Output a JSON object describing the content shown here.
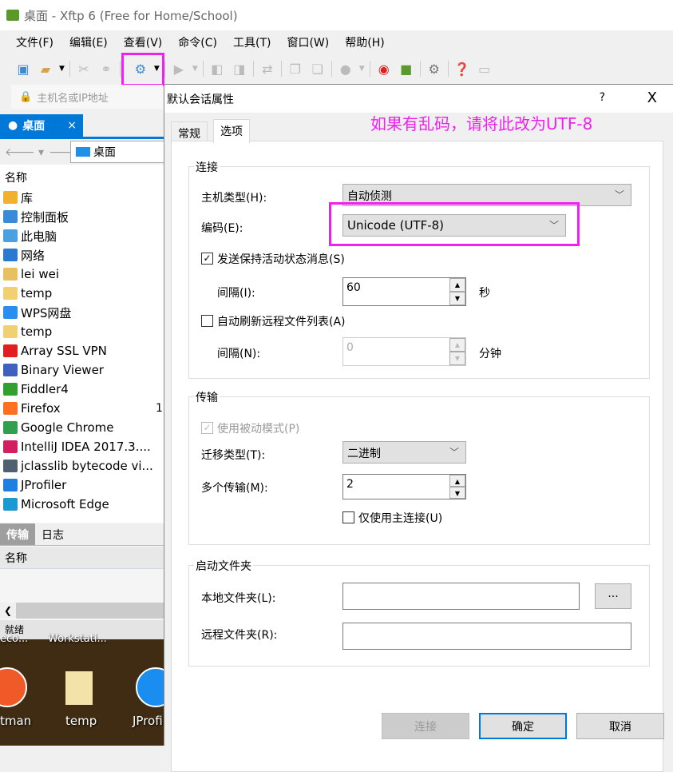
{
  "window": {
    "title": "桌面 - Xftp 6 (Free for Home/School)"
  },
  "menu": [
    "文件(F)",
    "编辑(E)",
    "查看(V)",
    "命令(C)",
    "工具(T)",
    "窗口(W)",
    "帮助(H)"
  ],
  "toolbar": {
    "icons": [
      "new-session-icon",
      "open-folder-icon",
      "disconnect-icon",
      "reconnect-icon",
      "default-session-properties-icon",
      "play-icon",
      "upload-icon",
      "download-icon",
      "sync-icon",
      "copy-icon",
      "paste-icon",
      "record-icon",
      "xshell-icon",
      "xftp-icon",
      "settings-icon",
      "help-icon",
      "chat-icon"
    ]
  },
  "address": {
    "placeholder": "主机名或IP地址"
  },
  "local": {
    "tab": "桌面",
    "path": "桌面",
    "column": "名称",
    "truncated_col": "1",
    "items": [
      {
        "name": "库",
        "color": "#f0b030"
      },
      {
        "name": "控制面板",
        "color": "#3a8ad8"
      },
      {
        "name": "此电脑",
        "color": "#4aa0e0"
      },
      {
        "name": "网络",
        "color": "#2b7ad0"
      },
      {
        "name": "lei wei",
        "color": "#e8c060"
      },
      {
        "name": "temp",
        "color": "#f0d070"
      },
      {
        "name": "WPS网盘",
        "color": "#2a8ef0"
      },
      {
        "name": "temp",
        "color": "#f0d070"
      },
      {
        "name": "Array SSL VPN",
        "color": "#e02020"
      },
      {
        "name": "Binary Viewer",
        "color": "#4060c0"
      },
      {
        "name": "Fiddler4",
        "color": "#30a030"
      },
      {
        "name": "Firefox",
        "color": "#ff7020"
      },
      {
        "name": "Google Chrome",
        "color": "#30a050"
      },
      {
        "name": "IntelliJ IDEA 2017.3....",
        "color": "#d02060"
      },
      {
        "name": "jclasslib bytecode vi...",
        "color": "#506070"
      },
      {
        "name": "JProfiler",
        "color": "#2080e0"
      },
      {
        "name": "Microsoft Edge",
        "color": "#1a9ad0"
      }
    ]
  },
  "transfer": {
    "tabs": [
      "传输",
      "日志"
    ],
    "column": "名称"
  },
  "status": "就绪",
  "desktop": {
    "top_labels": [
      "eco...",
      "Workstati..."
    ],
    "icons": [
      "tman",
      "temp",
      "JProfi"
    ]
  },
  "dialog": {
    "title": "默认会话属性",
    "help": "?",
    "close": "X",
    "tabs": [
      "常规",
      "选项"
    ],
    "active_tab": "选项",
    "annotation": "如果有乱码，请将此改为UTF-8",
    "connection": {
      "label": "连接",
      "host_type_label": "主机类型(H):",
      "host_type": "自动侦测",
      "encoding_label": "编码(E):",
      "encoding": "Unicode (UTF-8)",
      "keepalive_label": "发送保持活动状态消息(S)",
      "keepalive": true,
      "interval_label": "间隔(I):",
      "interval": "60",
      "interval_unit": "秒",
      "autorefresh_label": "自动刷新远程文件列表(A)",
      "autorefresh": false,
      "refresh_interval_label": "间隔(N):",
      "refresh_interval": "0",
      "refresh_unit": "分钟"
    },
    "transfer": {
      "label": "传输",
      "passive_label": "使用被动模式(P)",
      "passive": true,
      "type_label": "迁移类型(T):",
      "type": "二进制",
      "multi_label": "多个传输(M):",
      "multi": "2",
      "primary_only_label": "仅使用主连接(U)",
      "primary_only": false
    },
    "startup": {
      "label": "启动文件夹",
      "local_label": "本地文件夹(L):",
      "local": "",
      "browse": "...",
      "remote_label": "远程文件夹(R):",
      "remote": ""
    },
    "buttons": {
      "connect": "连接",
      "ok": "确定",
      "cancel": "取消"
    }
  },
  "colors": {
    "accent": "#0078d7",
    "highlight": "#f020f0"
  }
}
